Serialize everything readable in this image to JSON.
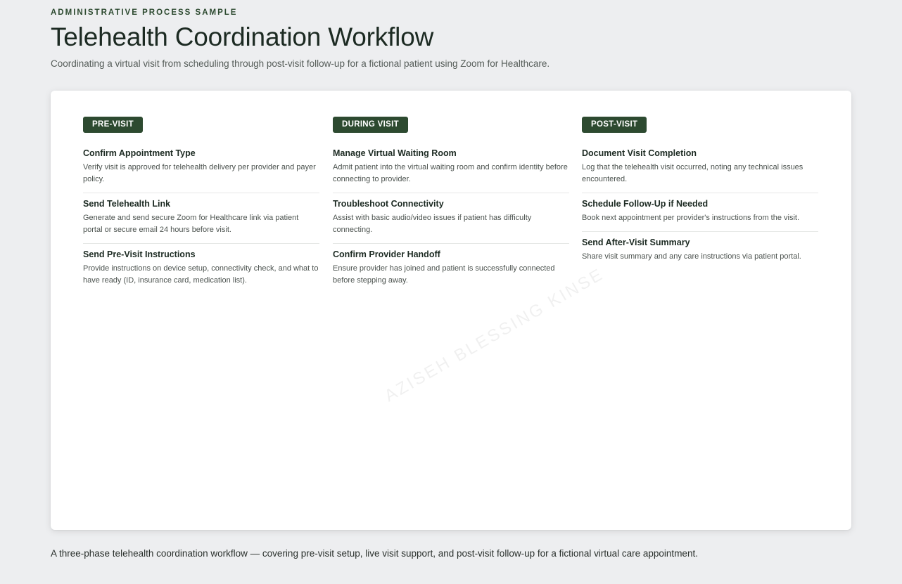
{
  "header": {
    "eyebrow": "ADMINISTRATIVE PROCESS SAMPLE",
    "title": "Telehealth Coordination Workflow",
    "subtitle": "Coordinating a virtual visit from scheduling through post-visit follow-up for a fictional patient using Zoom for Healthcare."
  },
  "watermark": "AZISEH BLESSING KINSE",
  "colors": {
    "accent": "#2d4a30",
    "background": "#edeef0",
    "card": "#ffffff"
  },
  "phases": [
    {
      "label": "PRE-VISIT",
      "steps": [
        {
          "title": "Confirm Appointment Type",
          "desc": "Verify visit is approved for telehealth delivery per provider and payer policy."
        },
        {
          "title": "Send Telehealth Link",
          "desc": "Generate and send secure Zoom for Healthcare link via patient portal or secure email 24 hours before visit."
        },
        {
          "title": "Send Pre-Visit Instructions",
          "desc": "Provide instructions on device setup, connectivity check, and what to have ready (ID, insurance card, medication list)."
        }
      ]
    },
    {
      "label": "DURING VISIT",
      "steps": [
        {
          "title": "Manage Virtual Waiting Room",
          "desc": "Admit patient into the virtual waiting room and confirm identity before connecting to provider."
        },
        {
          "title": "Troubleshoot Connectivity",
          "desc": "Assist with basic audio/video issues if patient has difficulty connecting."
        },
        {
          "title": "Confirm Provider Handoff",
          "desc": "Ensure provider has joined and patient is successfully connected before stepping away."
        }
      ]
    },
    {
      "label": "POST-VISIT",
      "steps": [
        {
          "title": "Document Visit Completion",
          "desc": "Log that the telehealth visit occurred, noting any technical issues encountered."
        },
        {
          "title": "Schedule Follow-Up if Needed",
          "desc": "Book next appointment per provider's instructions from the visit."
        },
        {
          "title": "Send After-Visit Summary",
          "desc": "Share visit summary and any care instructions via patient portal."
        }
      ]
    }
  ],
  "caption": "A three-phase telehealth coordination workflow — covering pre-visit setup, live visit support, and post-visit follow-up for a fictional virtual care appointment."
}
